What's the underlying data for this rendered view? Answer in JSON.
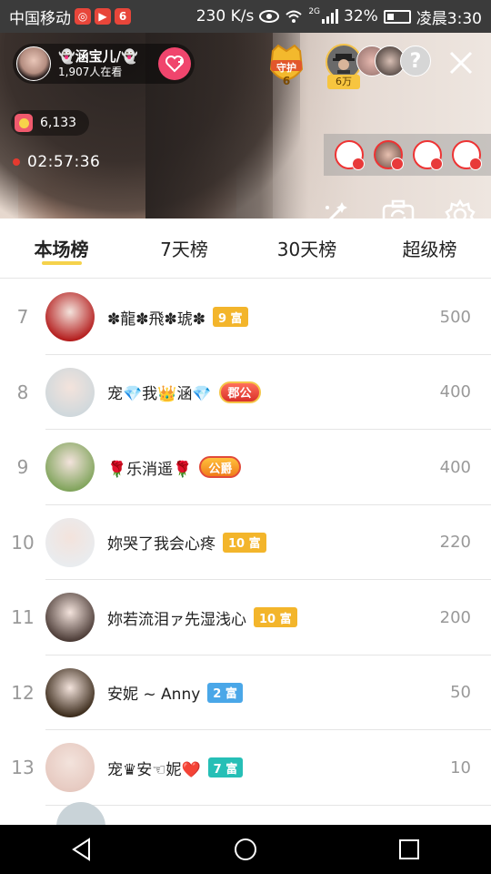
{
  "status_bar": {
    "carrier": "中国移动",
    "speed": "230 K/s",
    "network": "2G",
    "battery": "32%",
    "time": "凌晨3:30"
  },
  "live": {
    "host_name": "👻涵宝儿/👻",
    "viewers": "1,907人在看",
    "guard_label": "守护",
    "guard_count": "6",
    "top_fan_value": "6万",
    "coins": "6,133",
    "timer": "02:57:36"
  },
  "tabs": [
    {
      "label": "本场榜",
      "active": true
    },
    {
      "label": "7天榜",
      "active": false
    },
    {
      "label": "30天榜",
      "active": false
    },
    {
      "label": "超级榜",
      "active": false
    }
  ],
  "ranking": [
    {
      "rank": "7",
      "name": "✽龍✽飛✽琥✽",
      "badge_type": "level",
      "badge": "9 富",
      "badge_color": "#f3b52b",
      "score": "500",
      "avatar_color": "#b31b1b"
    },
    {
      "rank": "8",
      "name": "宠💎我👑涵💎",
      "badge_type": "title",
      "badge": "郡公",
      "score": "400",
      "avatar_color": "#cfd8dc"
    },
    {
      "rank": "9",
      "name": "🌹乐消遥🌹",
      "badge_type": "title_gold",
      "badge": "公爵",
      "score": "400",
      "avatar_color": "#7fa35a"
    },
    {
      "rank": "10",
      "name": "妳哭了我会心疼",
      "badge_type": "level",
      "badge": "10 富",
      "badge_color": "#f3b52b",
      "score": "220",
      "avatar_color": "#e9ecef"
    },
    {
      "rank": "11",
      "name": "妳若流泪ァ先湿浅心",
      "badge_type": "level",
      "badge": "10 富",
      "badge_color": "#f3b52b",
      "score": "200",
      "avatar_color": "#4a3a35"
    },
    {
      "rank": "12",
      "name": "安妮 ~ Anny",
      "badge_type": "level",
      "badge": "2 富",
      "badge_color": "#4aa7e8",
      "score": "50",
      "avatar_color": "#3a2a1a"
    },
    {
      "rank": "13",
      "name": "宠♛安☜妮❤️",
      "badge_type": "level",
      "badge": "7 富",
      "badge_color": "#26bfb6",
      "score": "10",
      "avatar_color": "#e6c9c0"
    }
  ]
}
